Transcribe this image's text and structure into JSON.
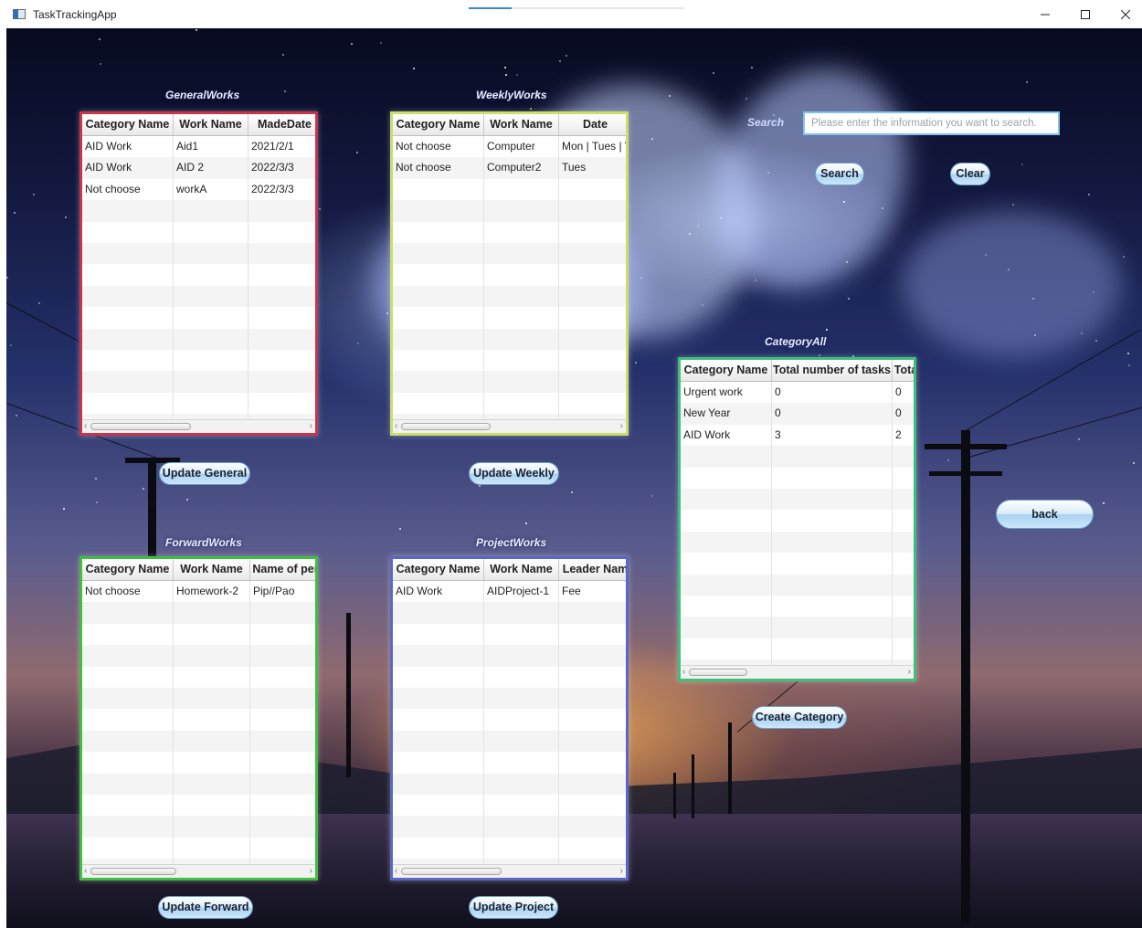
{
  "window": {
    "title": "TaskTrackingApp",
    "progress": 0.2
  },
  "search": {
    "label": "Search",
    "placeholder": "Please enter the information you want to search.",
    "value": "",
    "search_button": "Search",
    "clear_button": "Clear"
  },
  "general": {
    "title": "GeneralWorks",
    "columns": [
      "Category Name",
      "Work Name",
      "MadeDate"
    ],
    "rows": [
      [
        "AID Work",
        "Aid1",
        "2021/2/1"
      ],
      [
        "AID Work",
        "AID 2",
        "2022/3/3"
      ],
      [
        "Not choose",
        "workA",
        "2022/3/3"
      ]
    ],
    "button": "Update General"
  },
  "weekly": {
    "title": "WeeklyWorks",
    "columns": [
      "Category Name",
      "Work Name",
      "Date"
    ],
    "rows": [
      [
        "Not choose",
        "Computer",
        "Mon | Tues | V"
      ],
      [
        "Not choose",
        "Computer2",
        "Tues"
      ]
    ],
    "button": "Update Weekly"
  },
  "forward": {
    "title": "ForwardWorks",
    "columns": [
      "Category Name",
      "Work Name",
      "Name of per"
    ],
    "rows": [
      [
        "Not choose",
        "Homework-2",
        "Pip//Pao"
      ]
    ],
    "button": "Update Forward"
  },
  "project": {
    "title": "ProjectWorks",
    "columns": [
      "Category Name",
      "Work Name",
      "Leader Nam"
    ],
    "rows": [
      [
        "AID Work",
        "AIDProject-1",
        "Fee"
      ]
    ],
    "button": "Update Project"
  },
  "category": {
    "title": "CategoryAll",
    "columns": [
      "Category Name",
      "Total number of tasks",
      "Tota"
    ],
    "rows": [
      [
        "Urgent work",
        "0",
        "0"
      ],
      [
        "New Year",
        "0",
        "0"
      ],
      [
        "AID Work",
        "3",
        "2"
      ]
    ],
    "button": "Create Category"
  },
  "back_button": "back",
  "colors": {
    "general_border": "#c9344a",
    "weekly_border": "#c8e06a",
    "forward_border": "#3fbf3f",
    "project_border": "#5a66c8",
    "category_border": "#3fc07a"
  }
}
